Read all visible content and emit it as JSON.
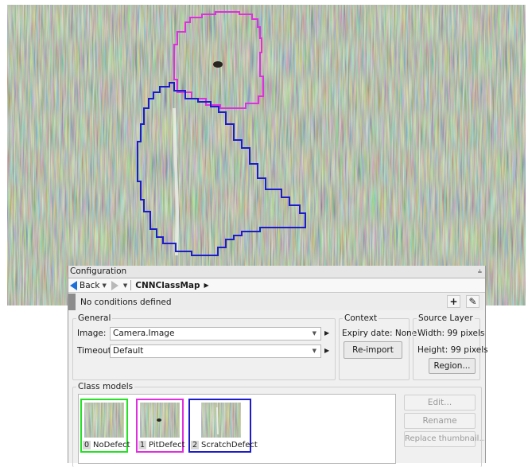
{
  "colors": {
    "nodefect": "#26e026",
    "pitdefect": "#e02ee0",
    "scratchdefect": "#1c1ccc",
    "nav_accent": "#1c6fd8"
  },
  "panel": {
    "title": "Configuration",
    "pin_icon": "pin-icon"
  },
  "nav": {
    "back_label": "Back",
    "crumb": "CNNClassMap"
  },
  "conditions": {
    "text": "No conditions defined"
  },
  "general": {
    "title": "General",
    "image_label": "Image:",
    "image_value": "Camera.Image",
    "timeout_label": "Timeout:",
    "timeout_value": "Default"
  },
  "context": {
    "title": "Context",
    "expiry": "Expiry date: None",
    "reimport_label": "Re-import"
  },
  "source_layer": {
    "title": "Source Layer",
    "width": "Width:  99 pixels",
    "height": "Height: 99 pixels",
    "region_label": "Region..."
  },
  "class_models": {
    "title": "Class models",
    "items": [
      {
        "index": "0",
        "name": "NoDefect"
      },
      {
        "index": "1",
        "name": "PitDefect"
      },
      {
        "index": "2",
        "name": "ScratchDefect"
      }
    ],
    "edit_label": "Edit...",
    "rename_label": "Rename",
    "replace_label": "Replace thumbnail..."
  }
}
